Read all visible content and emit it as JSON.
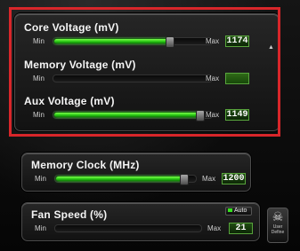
{
  "sliders": [
    {
      "id": "core",
      "title": "Core Voltage (mV)",
      "min_label": "Min",
      "max_label": "Max",
      "value": "1174",
      "fill_ratio": 0.74
    },
    {
      "id": "memory",
      "title": "Memory Voltage (mV)",
      "min_label": "Min",
      "max_label": "Max",
      "value": "",
      "fill_ratio": 0
    },
    {
      "id": "aux",
      "title": "Aux Voltage (mV)",
      "min_label": "Min",
      "max_label": "Max",
      "value": "1149",
      "fill_ratio": 0.93
    },
    {
      "id": "memclock",
      "title": "Memory Clock (MHz)",
      "min_label": "Min",
      "max_label": "Max",
      "value": "1200",
      "fill_ratio": 0.92
    },
    {
      "id": "fan",
      "title": "Fan Speed (%)",
      "min_label": "Min",
      "max_label": "Max",
      "value": "21",
      "fill_ratio": 0.0
    }
  ],
  "fan": {
    "auto_label": "Auto"
  },
  "user_define": {
    "label_line1": "User",
    "label_line2": "Define"
  },
  "colors": {
    "highlight": "#d8262a",
    "fill_green": "#25c312"
  }
}
